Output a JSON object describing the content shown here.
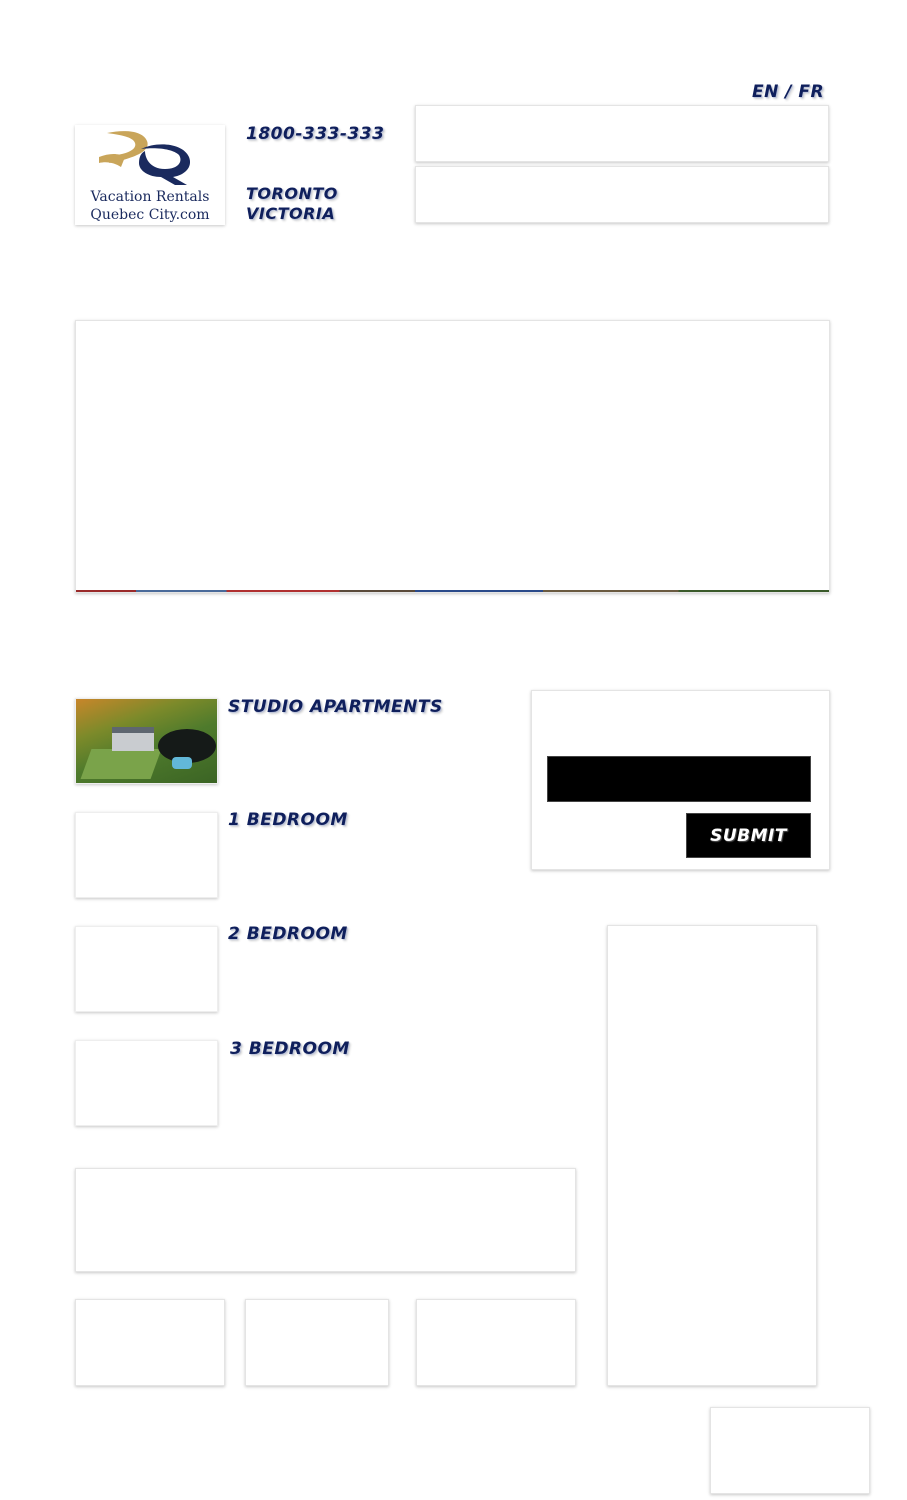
{
  "header": {
    "lang_en": "EN",
    "lang_sep": " / ",
    "lang_fr": "FR",
    "phone": "1800-333-333",
    "cities": [
      "TORONTO",
      "VICTORIA"
    ]
  },
  "logo": {
    "line1": "Vacation Rentals",
    "line2": "Quebec City.com",
    "colors": {
      "gold": "#c9a55a",
      "navy": "#1a2a5e"
    }
  },
  "apartments": [
    {
      "label": "STUDIO APARTMENTS",
      "has_photo": true
    },
    {
      "label": "1 BEDROOM"
    },
    {
      "label": "2 BEDROOM"
    },
    {
      "label": "3 BEDROOM"
    }
  ],
  "form": {
    "input_value": "",
    "submit_label": "SUBMIT"
  },
  "colors": {
    "heading": "#0f1f5c",
    "button_bg": "#000000"
  }
}
